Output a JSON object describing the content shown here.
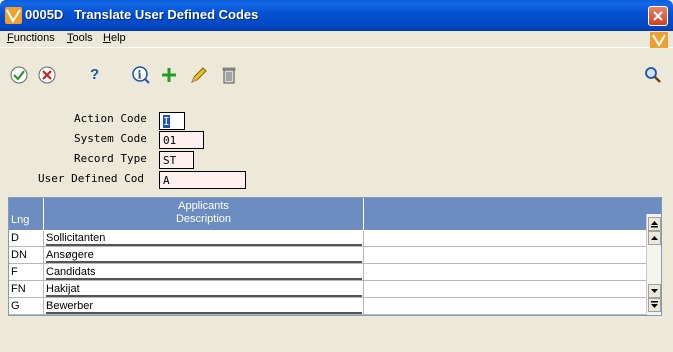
{
  "window": {
    "title": "0005D   Translate User Defined Codes"
  },
  "menu": {
    "items": [
      {
        "key": "F",
        "rest": "unctions"
      },
      {
        "key": "T",
        "rest": "ools"
      },
      {
        "key": "H",
        "rest": "elp"
      }
    ]
  },
  "toolbar": {
    "icons": [
      "ok-check-icon",
      "cancel-x-icon",
      "help-question-icon",
      "info-icon",
      "add-plus-icon",
      "edit-pencil-icon",
      "delete-trash-icon",
      "search-magnifier-icon"
    ]
  },
  "form": {
    "action_code_label": "Action Code",
    "action_code_value": "I",
    "system_code_label": "System Code",
    "system_code_value": "01",
    "record_type_label": "Record Type",
    "record_type_value": "ST",
    "udc_label": "User Defined Cod",
    "udc_value": "A"
  },
  "grid": {
    "header_lng": "Lng",
    "header_desc_line1": "Applicants",
    "header_desc_line2": "Description",
    "rows": [
      {
        "lng": "D",
        "desc": "Sollicitanten"
      },
      {
        "lng": "DN",
        "desc": "Ansøgere"
      },
      {
        "lng": "F",
        "desc": "Candidats"
      },
      {
        "lng": "FN",
        "desc": "Hakijat"
      },
      {
        "lng": "G",
        "desc": "Bewerber"
      }
    ]
  },
  "colors": {
    "titlebar": "#0553d3",
    "grid_header": "#6d8cbf",
    "input_bg": "#fff0f0"
  }
}
